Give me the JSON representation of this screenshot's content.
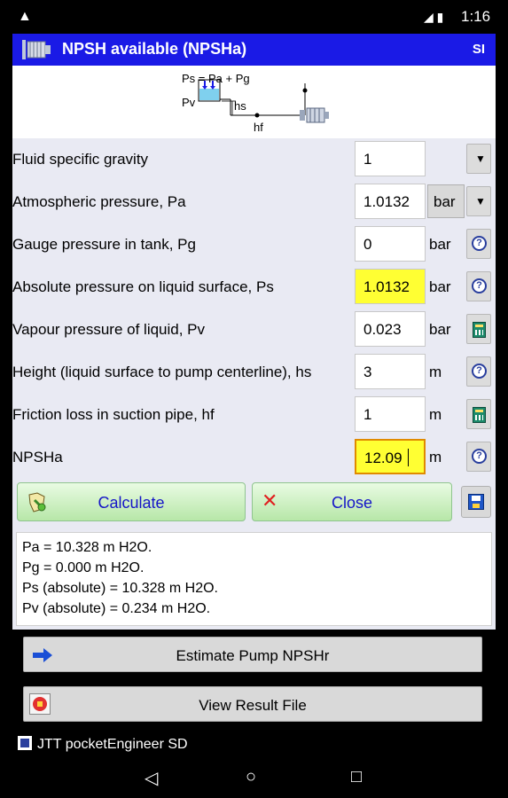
{
  "status_bar": {
    "warning_icon": "warning-triangle-icon",
    "icons_label": "◢ ▮",
    "time": "1:16"
  },
  "title_bar": {
    "icon": "pump-icon",
    "title": "NPSH available (NPSHa)",
    "units": "SI"
  },
  "diagram": {
    "formula": "Ps = Pa + Pg",
    "pv_label": "Pv",
    "hs_label": "hs",
    "hf_label": "hf"
  },
  "form": {
    "rows": [
      {
        "label": "Fluid specific gravity",
        "value": "1",
        "unit": "",
        "side_icon": "dropdown-arrow-icon"
      },
      {
        "label": "Atmospheric pressure, Pa",
        "value": "1.0132",
        "unit": "bar",
        "side_icon": "dropdown-arrow-icon"
      },
      {
        "label": "Gauge pressure in tank, Pg",
        "value": "0",
        "unit": "bar",
        "side_icon": "help-icon"
      },
      {
        "label": "Absolute pressure on liquid surface, Ps",
        "value": "1.0132",
        "unit": "bar",
        "side_icon": "help-icon"
      },
      {
        "label": "Vapour pressure of liquid, Pv",
        "value": "0.023",
        "unit": "bar",
        "side_icon": "calculator-icon"
      },
      {
        "label": "Height (liquid surface to pump centerline), hs",
        "value": "3",
        "unit": "m",
        "side_icon": "help-icon"
      },
      {
        "label": "Friction loss in suction pipe, hf",
        "value": "1",
        "unit": "m",
        "side_icon": "calculator-icon"
      },
      {
        "label": "NPSHa",
        "value": "12.09",
        "unit": "m",
        "side_icon": "help-icon"
      }
    ],
    "dropdown_glyph": "▼",
    "help_glyph": "?"
  },
  "buttons": {
    "calculate": "Calculate",
    "close": "Close",
    "close_glyph": "✕",
    "save_icon": "save-disk-icon"
  },
  "results": {
    "lines": [
      "Pa = 10.328 m H2O.",
      "Pg = 0.000 m H2O.",
      "Ps (absolute) = 10.328 m H2O.",
      "Pv (absolute) = 0.234 m H2O."
    ]
  },
  "actions": {
    "estimate": "Estimate Pump NPSHr",
    "view_result": "View Result File"
  },
  "footer": {
    "app_name": "JTT pocketEngineer SD"
  },
  "nav": {
    "back": "◁",
    "home": "○",
    "recents": "□"
  },
  "colors": {
    "title_bar": "#1a1ae6",
    "highlight_field": "#ffff33",
    "button_text": "#1515c8",
    "form_background": "#e9eaf3"
  }
}
